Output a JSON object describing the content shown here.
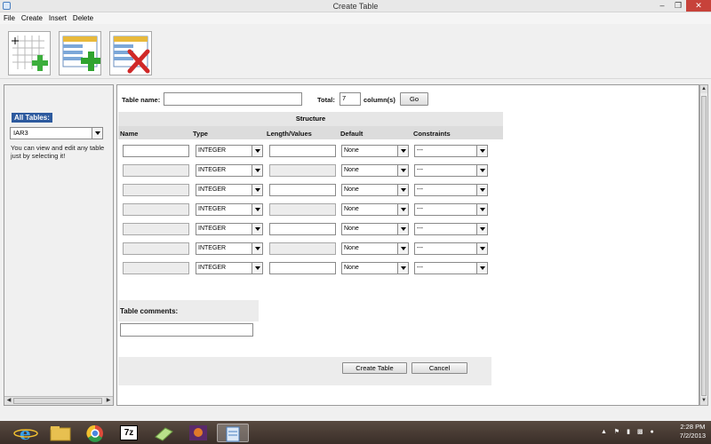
{
  "window": {
    "title": "Create Table"
  },
  "menu": [
    "File",
    "Create",
    "Insert",
    "Delete"
  ],
  "left": {
    "all_tables_label": "All Tables:",
    "selected_table": "IAR3",
    "help_text": "You can view and edit any table just by selecting it!"
  },
  "main": {
    "table_name_label": "Table name:",
    "table_name_value": "",
    "total_label": "Total:",
    "total_value": "7",
    "columns_label": "column(s)",
    "go_label": "Go",
    "structure_label": "Structure",
    "headers": [
      "Name",
      "Type",
      "Length/Values",
      "Default",
      "Constraints"
    ],
    "rows": [
      {
        "type": "INTEGER",
        "default": "None",
        "constraint": "---"
      },
      {
        "type": "INTEGER",
        "default": "None",
        "constraint": "---"
      },
      {
        "type": "INTEGER",
        "default": "None",
        "constraint": "---"
      },
      {
        "type": "INTEGER",
        "default": "None",
        "constraint": "---"
      },
      {
        "type": "INTEGER",
        "default": "None",
        "constraint": "---"
      },
      {
        "type": "INTEGER",
        "default": "None",
        "constraint": "---"
      },
      {
        "type": "INTEGER",
        "default": "None",
        "constraint": "---"
      }
    ],
    "comments_label": "Table comments:",
    "create_label": "Create Table",
    "cancel_label": "Cancel"
  },
  "taskbar": {
    "time": "2:28 PM",
    "date": "7/2/2013",
    "seven_zip_label": "7z"
  }
}
